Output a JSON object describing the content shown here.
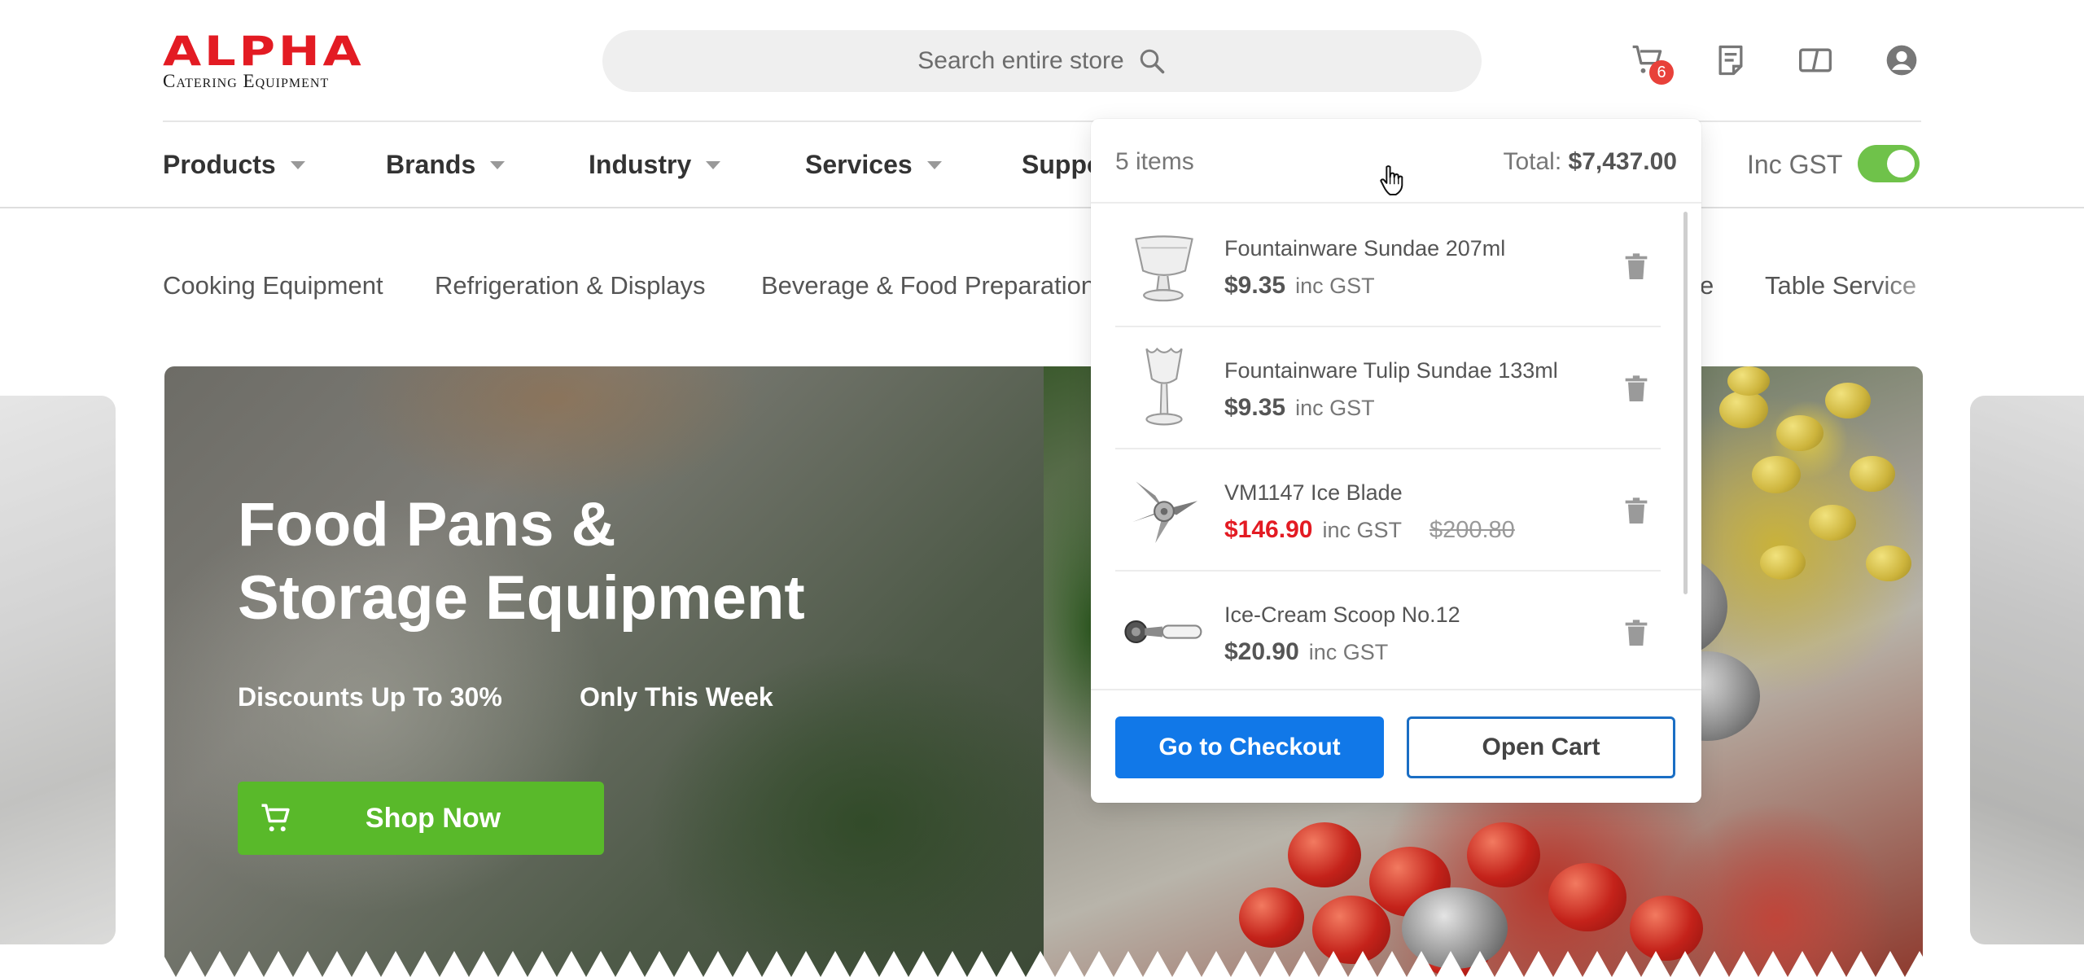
{
  "header": {
    "logo_main": "ALPHA",
    "logo_sub": "Catering Equipment",
    "search_placeholder": "Search entire store",
    "cart_badge": "6",
    "icons": [
      "cart-icon",
      "quote-list-icon",
      "compare-icon",
      "account-icon"
    ]
  },
  "nav": {
    "items": [
      "Products",
      "Brands",
      "Industry",
      "Services",
      "Support"
    ],
    "inc_gst_label": "Inc GST",
    "inc_gst_enabled": true
  },
  "categories": [
    "Cooking Equipment",
    "Refrigeration & Displays",
    "Beverage & Food Preparation",
    "e",
    "Table Service"
  ],
  "hero": {
    "title_line1": "Food Pans &",
    "title_line2": "Storage Equipment",
    "sub1": "Discounts Up To 30%",
    "sub2": "Only This Week",
    "cta": "Shop Now"
  },
  "minicart": {
    "count_label": "5 items",
    "total_label": "Total:",
    "total_value": "$7,437.00",
    "items": [
      {
        "name": "Fountainware Sundae 207ml",
        "price": "$9.35",
        "gst": "inc GST",
        "old_price": "",
        "on_sale": false
      },
      {
        "name": "Fountainware Tulip Sundae 133ml",
        "price": "$9.35",
        "gst": "inc GST",
        "old_price": "",
        "on_sale": false
      },
      {
        "name": "VM1147 Ice Blade",
        "price": "$146.90",
        "gst": "inc GST",
        "old_price": "$200.80",
        "on_sale": true
      },
      {
        "name": "Ice-Cream Scoop No.12",
        "price": "$20.90",
        "gst": "inc GST",
        "old_price": "",
        "on_sale": false
      }
    ],
    "checkout_label": "Go to Checkout",
    "open_cart_label": "Open Cart"
  },
  "colors": {
    "brand_red": "#e31b23",
    "cta_green": "#59b92a",
    "checkout_blue": "#1178e8",
    "toggle_green": "#6fc24a",
    "badge_red": "#e8413a"
  }
}
